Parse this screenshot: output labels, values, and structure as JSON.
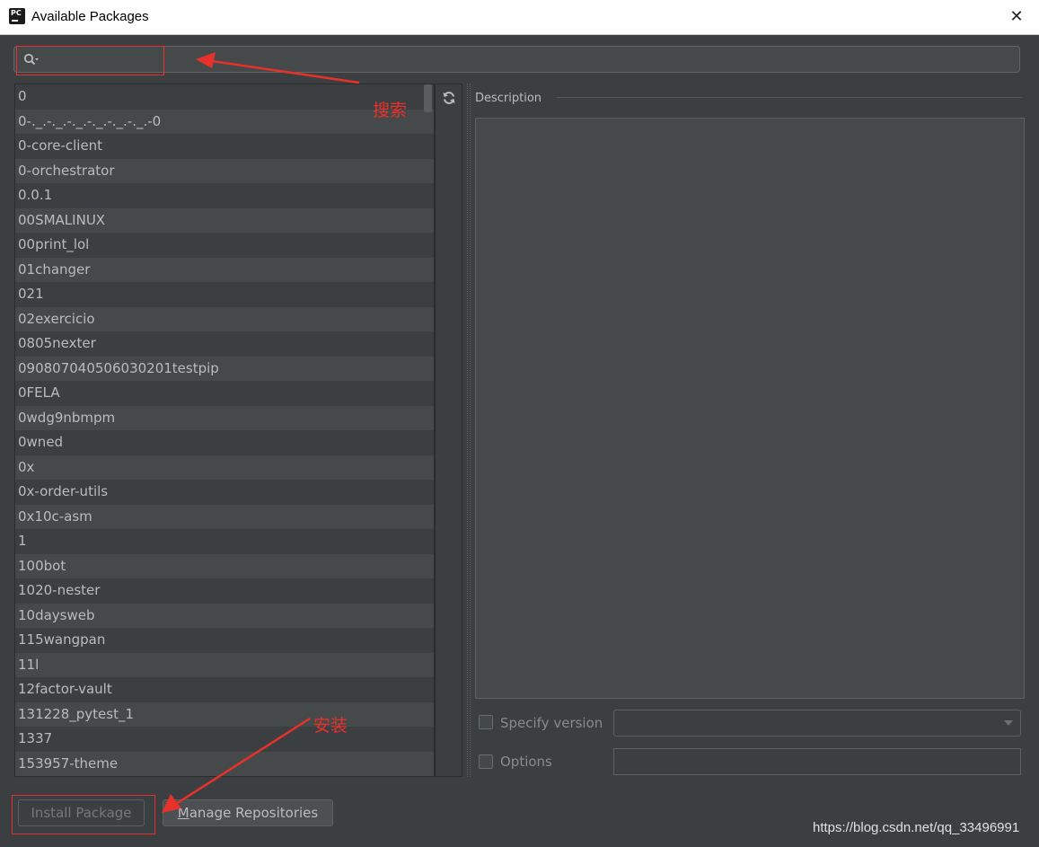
{
  "window": {
    "title": "Available Packages",
    "close_glyph": "✕",
    "app_icon_text": "PC"
  },
  "search": {
    "value": "",
    "placeholder": ""
  },
  "packages": [
    "0",
    "0-._.-._.-._.-._.-._.-._.-0",
    "0-core-client",
    "0-orchestrator",
    "0.0.1",
    "00SMALINUX",
    "00print_lol",
    "01changer",
    "021",
    "02exercicio",
    "0805nexter",
    "090807040506030201testpip",
    "0FELA",
    "0wdg9nbmpm",
    "0wned",
    "0x",
    "0x-order-utils",
    "0x10c-asm",
    "1",
    "100bot",
    "1020-nester",
    "10daysweb",
    "115wangpan",
    "11l",
    "12factor-vault",
    "131228_pytest_1",
    "1337",
    "153957-theme"
  ],
  "description": {
    "label": "Description",
    "text": ""
  },
  "options_panel": {
    "specify_version_label": "Specify version",
    "specify_version_checked": false,
    "version_value": "",
    "options_label": "Options",
    "options_checked": false,
    "options_value": ""
  },
  "buttons": {
    "install": "Install Package",
    "manage_mnemonic": "M",
    "manage_rest": "anage Repositories"
  },
  "annotations": {
    "search_note": "搜索",
    "install_note": "安装",
    "color": "#e8312a"
  },
  "watermark": "https://blog.csdn.net/qq_33496991",
  "icons": [
    "app-icon",
    "close-icon",
    "search-icon",
    "refresh-icon",
    "chevron-down-icon"
  ]
}
